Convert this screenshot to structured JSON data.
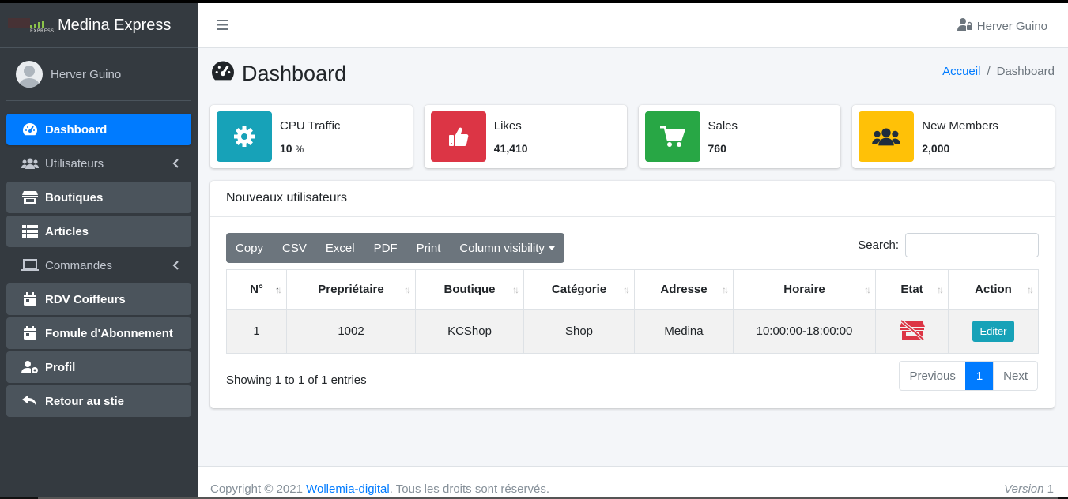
{
  "brand": {
    "logo_text": "EXPRESS",
    "name": "Medina Express"
  },
  "user": {
    "name": "Herver Guino"
  },
  "sidebar": {
    "items": [
      {
        "label": "Dashboard",
        "icon": "tachometer-icon",
        "state": "active"
      },
      {
        "label": "Utilisateurs",
        "icon": "users-icon",
        "state": "plain",
        "caret": true
      },
      {
        "label": "Boutiques",
        "icon": "store-icon",
        "state": "btn"
      },
      {
        "label": "Articles",
        "icon": "list-icon",
        "state": "btn"
      },
      {
        "label": "Commandes",
        "icon": "laptop-icon",
        "state": "plain",
        "caret": true
      },
      {
        "label": "RDV Coiffeurs",
        "icon": "calendar-icon",
        "state": "btn"
      },
      {
        "label": "Fomule d'Abonnement",
        "icon": "calendar-icon",
        "state": "btn"
      },
      {
        "label": "Profil",
        "icon": "user-cog-icon",
        "state": "btn"
      },
      {
        "label": "Retour au stie",
        "icon": "reply-icon",
        "state": "btn"
      }
    ]
  },
  "header": {
    "user_name": "Herver Guino"
  },
  "page": {
    "title": "Dashboard",
    "breadcrumb": [
      "Accueil",
      "Dashboard"
    ]
  },
  "info_boxes": [
    {
      "label": "CPU Traffic",
      "value": "10",
      "unit": "%",
      "icon": "gear-icon",
      "color": "#17a2b8"
    },
    {
      "label": "Likes",
      "value": "41,410",
      "unit": "",
      "icon": "thumbs-up-icon",
      "color": "#dc3545"
    },
    {
      "label": "Sales",
      "value": "760",
      "unit": "",
      "icon": "shopping-cart-icon",
      "color": "#28a745"
    },
    {
      "label": "New Members",
      "value": "2,000",
      "unit": "",
      "icon": "users-icon",
      "color": "#ffc107"
    }
  ],
  "table_card": {
    "title": "Nouveaux utilisateurs",
    "buttons": [
      "Copy",
      "CSV",
      "Excel",
      "PDF",
      "Print",
      "Column visibility"
    ],
    "search_label": "Search:",
    "search_value": "",
    "columns": [
      "N°",
      "Prepriétaire",
      "Boutique",
      "Catégorie",
      "Adresse",
      "Horaire",
      "Etat",
      "Action"
    ],
    "rows": [
      {
        "num": "1",
        "owner": "1002",
        "shop": "KCShop",
        "category": "Shop",
        "address": "Medina",
        "hours": "10:00:00-18:00:00",
        "state_icon": "store-closed-icon",
        "action": "Editer"
      }
    ],
    "showing": "Showing 1 to 1 of 1 entries",
    "pagination": {
      "previous": "Previous",
      "current": "1",
      "next": "Next"
    }
  },
  "footer": {
    "copyright": "Copyright © 2021",
    "company": "Wollemia-digital",
    "rights": ". Tous les droits sont réservés.",
    "version_label": "Version",
    "version": "1"
  },
  "colors": {
    "primary": "#007bff",
    "sidebar": "#343a40",
    "info": "#17a2b8",
    "danger": "#dc3545",
    "success": "#28a745",
    "warning": "#ffc107"
  }
}
